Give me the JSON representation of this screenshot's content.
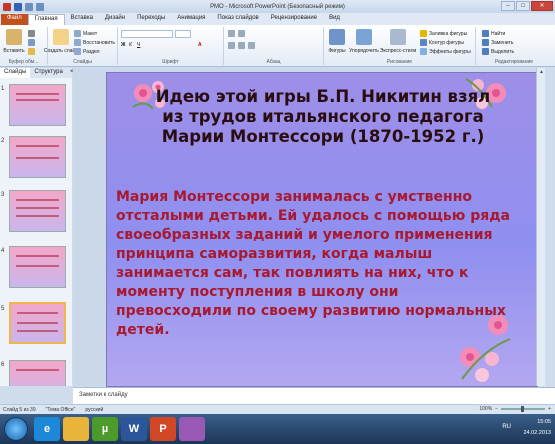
{
  "window": {
    "title": "РМО - Microsoft PowerPoint (Безопасный режим)"
  },
  "ribbon_tabs": [
    "Файл",
    "Главная",
    "Вставка",
    "Дизайн",
    "Переходы",
    "Анимация",
    "Показ слайдов",
    "Рецензирование",
    "Вид"
  ],
  "ribbon": {
    "clipboard": {
      "label": "Буфер обм...",
      "paste": "Вставить"
    },
    "slides": {
      "label": "Слайды",
      "new_slide": "Создать слайд",
      "layout": "Макет",
      "reset": "Восстановить",
      "section": "Раздел"
    },
    "font": {
      "label": "Шрифт"
    },
    "paragraph": {
      "label": "Абзац"
    },
    "drawing": {
      "label": "Рисование",
      "shapes": "Фигуры",
      "arrange": "Упорядочить",
      "quick_styles": "Экспресс-стили",
      "fill": "Заливка фигуры",
      "outline": "Контур фигуры",
      "effects": "Эффекты фигуры"
    },
    "editing": {
      "label": "Редактирование",
      "find": "Найти",
      "replace": "Заменить",
      "select": "Выделить"
    }
  },
  "left_panel": {
    "tabs": [
      "Слайды",
      "Структура"
    ],
    "close": "×",
    "thumbnails": [
      {
        "num": "1"
      },
      {
        "num": "2"
      },
      {
        "num": "3"
      },
      {
        "num": "4"
      },
      {
        "num": "5"
      },
      {
        "num": "6"
      }
    ]
  },
  "slide": {
    "title": "Идею этой игры Б.П. Никитин взял из трудов итальянского педагога Марии Монтессори (1870-1952 г.)",
    "body": "Мария Монтессори занималась с умственно отсталыми детьми. Ей удалось с помощью ряда своеобразных заданий и  умелого применения принципа саморазвития, когда малыш занимается сам, так повлиять на них, что к моменту  поступления в школу они превосходили по своему развитию нормальных детей."
  },
  "notes": {
    "placeholder": "Заметки к слайду"
  },
  "status": {
    "slide_info": "Слайд 5 из 39",
    "theme": "\"Тема Office\"",
    "language": "русский",
    "zoom": "100%"
  },
  "taskbar": {
    "apps": [
      {
        "label": "e",
        "color": "#1e88d8"
      },
      {
        "label": "",
        "color": "#e8b43a"
      },
      {
        "label": "µ",
        "color": "#4c9a2a"
      },
      {
        "label": "W",
        "color": "#2b579a"
      },
      {
        "label": "P",
        "color": "#d24726"
      },
      {
        "label": "",
        "color": "#9b59b6"
      }
    ],
    "lang": "RU",
    "time": "15:05",
    "date": "24.02.2013"
  },
  "colors": {
    "title_text": "#2a0d10",
    "body_text": "#a8192f",
    "slide_bg": "#9e8fe8"
  }
}
